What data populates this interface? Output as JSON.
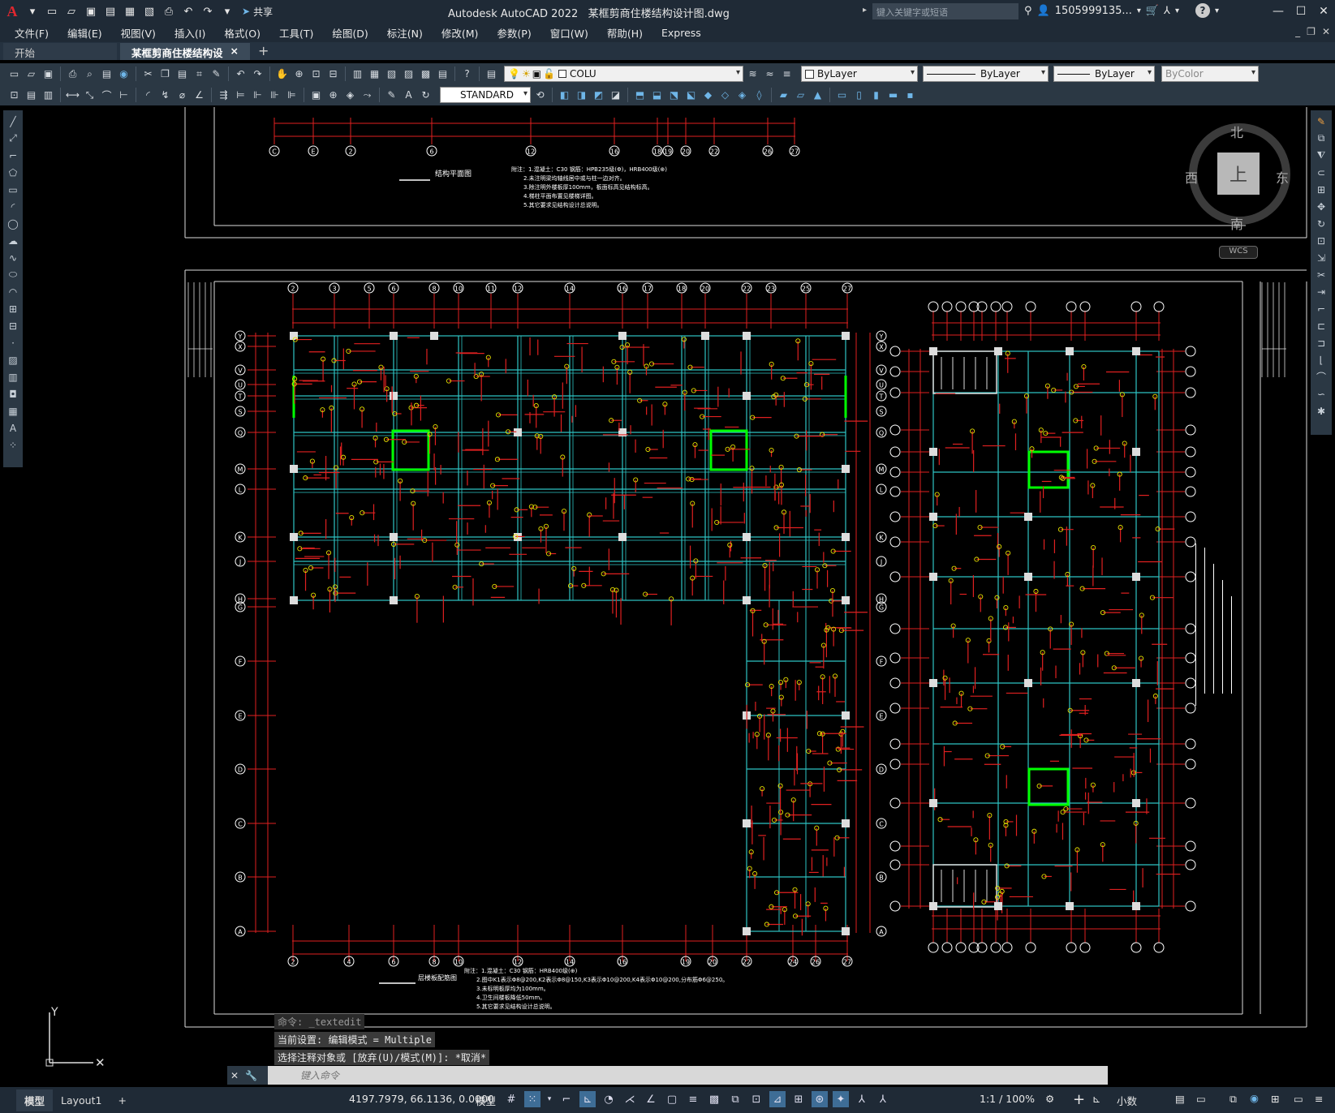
{
  "app": {
    "logo": "A",
    "title": "Autodesk AutoCAD 2022",
    "filename": "某框剪商住楼结构设计图.dwg",
    "share_label": "共享",
    "search_placeholder": "键入关键字或短语",
    "user": "1505999135...",
    "help": "?"
  },
  "menu": {
    "items": [
      "文件(F)",
      "编辑(E)",
      "视图(V)",
      "插入(I)",
      "格式(O)",
      "工具(T)",
      "绘图(D)",
      "标注(N)",
      "修改(M)",
      "参数(P)",
      "窗口(W)",
      "帮助(H)",
      "Express"
    ]
  },
  "tabs": {
    "start": "开始",
    "active": "某框剪商住楼结构设计图*",
    "close": "×",
    "add": "+"
  },
  "toolbar": {
    "layer_value": "COLU",
    "color_value": "ByLayer",
    "linetype_value": "ByLayer",
    "lineweight_value": "ByLayer",
    "plotstyle_value": "ByColor",
    "textstyle_value": "STANDARD"
  },
  "viewcube": {
    "north": "北",
    "south": "南",
    "east": "东",
    "west": "西",
    "top": "上",
    "wcs": "WCS"
  },
  "drawing": {
    "plan_title_top": "结构平面图",
    "plan_title_bottom": "层楼板配筋图",
    "notes_top": [
      "附注：1.混凝土：C30  钢筋：HPB235级(Φ)，HRB400级(⊕)",
      "2.未注明梁均轴线居中或与柱一边对齐。",
      "3.除注明外楼板厚100mm，板面标高见结构标高。",
      "4.梯柱平面布置见楼梯详图。",
      "5.其它要求见结构设计总说明。"
    ],
    "notes_bottom": [
      "附注：1.混凝土：C30  钢筋：HRB400级(⊕)",
      "2.图中K1表示Φ8@200,K2表示Φ8@150,K3表示Φ10@200,K4表示Φ10@200,分布筋Φ6@250。",
      "3.未标明板厚均为100mm。",
      "4.卫生间楼板降低50mm。",
      "5.其它要求见结构设计总说明。"
    ],
    "axes_top": [
      "2",
      "3",
      "5",
      "6",
      "8",
      "10",
      "11",
      "12",
      "14",
      "16",
      "17",
      "18",
      "20",
      "22",
      "23",
      "25",
      "27"
    ],
    "axes_bottom": [
      "2",
      "4",
      "6",
      "8",
      "10",
      "12",
      "14",
      "16",
      "19",
      "20",
      "22",
      "24",
      "26",
      "27"
    ],
    "axes_left": [
      "Y",
      "X",
      "V",
      "U",
      "T",
      "S",
      "Q",
      "M",
      "L",
      "K",
      "J",
      "H",
      "G",
      "F",
      "E",
      "D",
      "C",
      "B",
      "A"
    ],
    "axes_prev": [
      "C",
      "E",
      "2",
      "6",
      "12",
      "16",
      "18",
      "19",
      "20",
      "22",
      "26",
      "27"
    ]
  },
  "command": {
    "history": [
      "命令: _textedit",
      "当前设置: 编辑模式 = Multiple",
      "选择注释对象或 [放弃(U)/模式(M)]: *取消*"
    ],
    "placeholder": "键入命令"
  },
  "status": {
    "model_tab": "模型",
    "layout_tab": "Layout1",
    "add_tab": "+",
    "coords": "4197.7979, 66.1136, 0.0000",
    "model_label": "模型",
    "scale": "1:1 / 100%",
    "units": "小数"
  },
  "colors": {
    "titlebar": "#1f2a36",
    "canvas": "#000000",
    "wall": "#2ec4c4",
    "rebar": "#e02020",
    "axis": "#ffffff",
    "highlight": "#00ff00",
    "tag": "#e8e000"
  }
}
